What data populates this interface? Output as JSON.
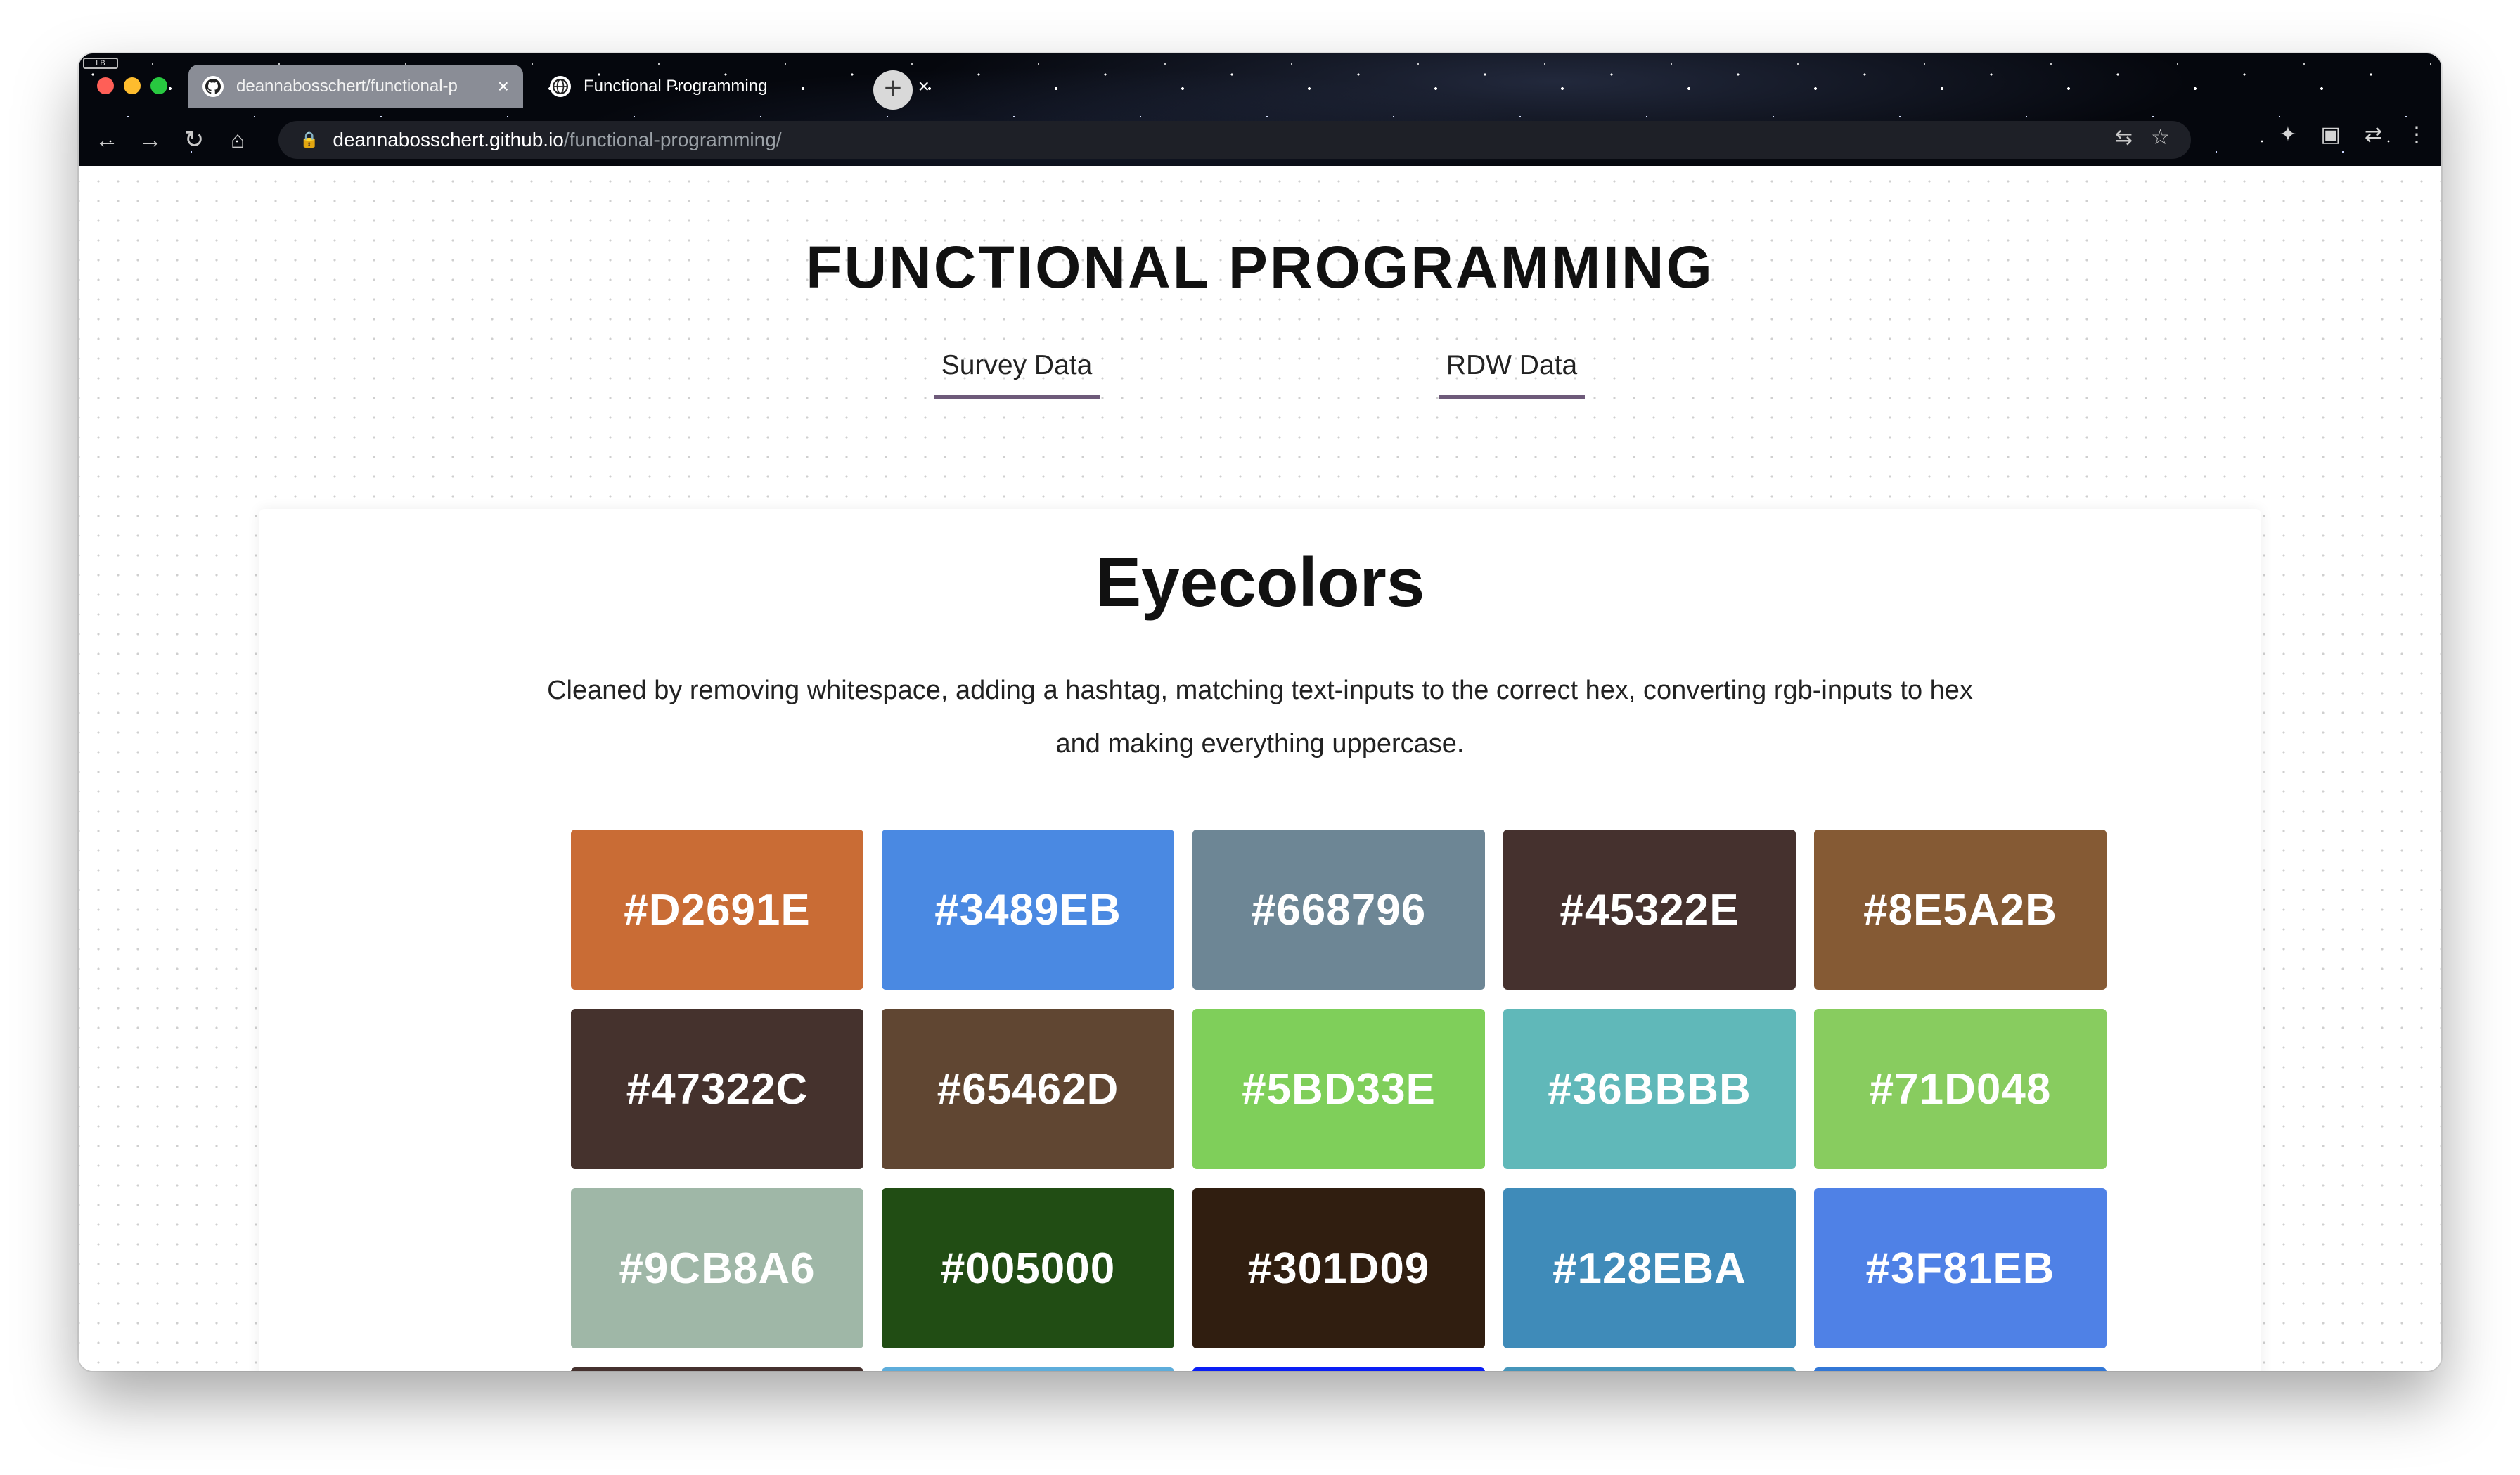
{
  "browser": {
    "profile_badge": "LB",
    "tabs": [
      {
        "title": "deannabosschert/functional-p",
        "active": true,
        "icon": "github-icon"
      },
      {
        "title": "Functional Programming",
        "active": false,
        "icon": "globe-icon"
      }
    ],
    "close_glyph": "×",
    "new_tab_glyph": "+",
    "url_domain": "deannabosschert.github.io",
    "url_path": "/functional-programming/"
  },
  "page": {
    "site_title": "FUNCTIONAL  PROGRAMMING",
    "nav": {
      "survey": "Survey Data",
      "rdw": "RDW Data"
    },
    "section_title": "Eyecolors",
    "description": "Cleaned by removing whitespace, adding a hashtag, matching text-inputs to the correct hex, converting rgb-inputs to hex and making everything uppercase."
  },
  "swatches": [
    {
      "label": "#D2691E",
      "color": "#C96C35"
    },
    {
      "label": "#3489EB",
      "color": "#4A89E2"
    },
    {
      "label": "#668796",
      "color": "#6D8695"
    },
    {
      "label": "#45322E",
      "color": "#45312E"
    },
    {
      "label": "#8E5A2B",
      "color": "#855A34"
    },
    {
      "label": "#47322C",
      "color": "#45322D"
    },
    {
      "label": "#65462D",
      "color": "#604632"
    },
    {
      "label": "#5BD33E",
      "color": "#7FCF5A"
    },
    {
      "label": "#36BBBB",
      "color": "#60B8B9"
    },
    {
      "label": "#71D048",
      "color": "#88CC5F"
    },
    {
      "label": "#9CB8A6",
      "color": "#9FB7A7"
    },
    {
      "label": "#005000",
      "color": "#214D14"
    },
    {
      "label": "#301D09",
      "color": "#301E10"
    },
    {
      "label": "#128EBA",
      "color": "#3F8BB9"
    },
    {
      "label": "#3F81EB",
      "color": "#4F81E6"
    },
    {
      "label": "",
      "color": "#45312E"
    },
    {
      "label": "",
      "color": "#5EADDB"
    },
    {
      "label": "",
      "color": "#0A1EF5"
    },
    {
      "label": "",
      "color": "#4595BA"
    },
    {
      "label": "",
      "color": "#3277D6"
    }
  ]
}
